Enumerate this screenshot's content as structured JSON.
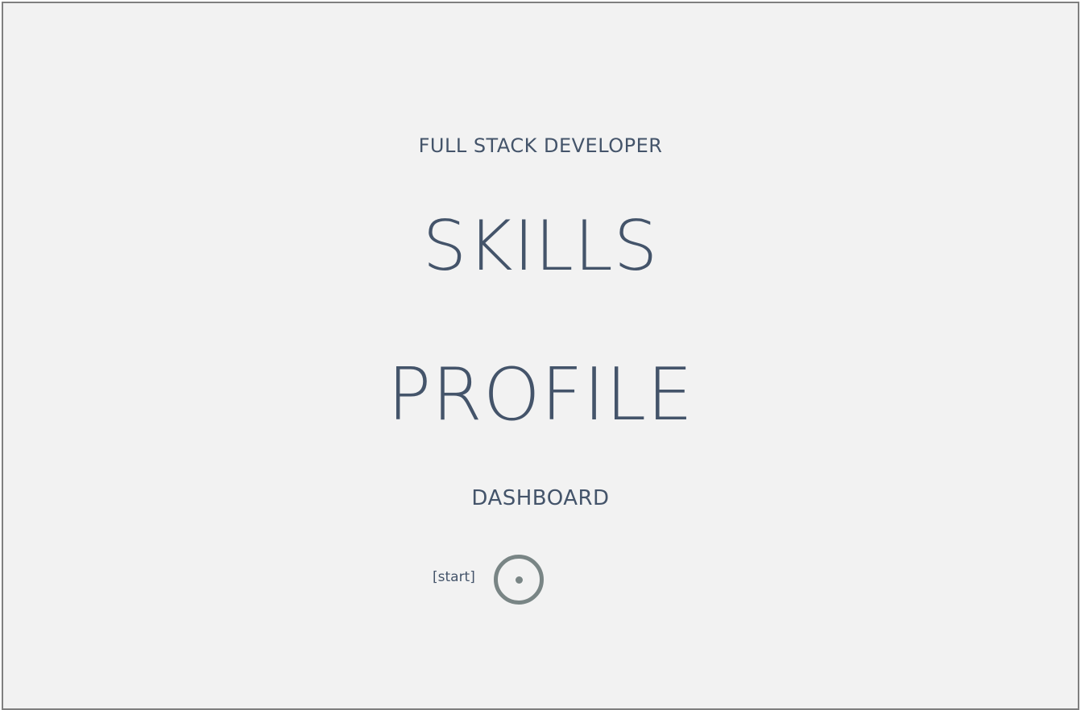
{
  "header": {
    "subtitle": "FULL STACK DEVELOPER",
    "title_line1": "SKILLS",
    "title_line2": "PROFILE",
    "tagline": "DASHBOARD"
  },
  "start": {
    "label": "[start]",
    "icon": "radio-target-icon"
  },
  "colors": {
    "background": "#f2f2f2",
    "border": "#7f7f7f",
    "text": "#44546a",
    "button": "#798585"
  }
}
